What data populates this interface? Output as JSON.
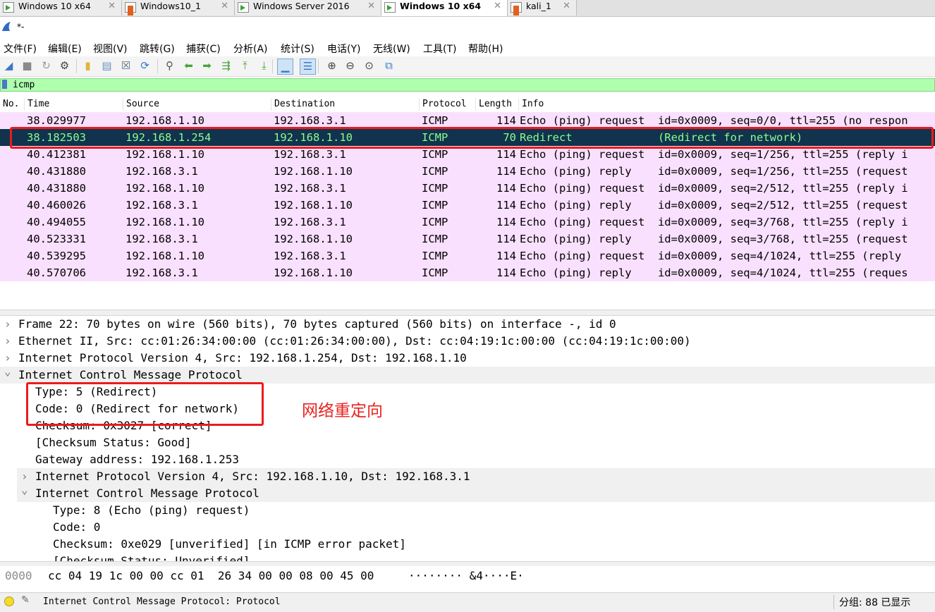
{
  "vm_tabs": [
    {
      "label": "Windows 10 x64",
      "icon": "vm-icon",
      "active": false
    },
    {
      "label": "Windows10_1",
      "icon": "vm-red-icon",
      "active": false
    },
    {
      "label": "Windows Server 2016",
      "icon": "vm-icon",
      "active": false
    },
    {
      "label": "Windows 10 x64",
      "icon": "vm-icon",
      "active": true
    },
    {
      "label": "kali_1",
      "icon": "vm-red-icon",
      "active": false
    }
  ],
  "close_glyph": "✕",
  "app": {
    "title": "*-",
    "icon": "shark-fin-icon"
  },
  "menu": [
    "文件(F)",
    "编辑(E)",
    "视图(V)",
    "跳转(G)",
    "捕获(C)",
    "分析(A)",
    "统计(S)",
    "电话(Y)",
    "无线(W)",
    "工具(T)",
    "帮助(H)"
  ],
  "toolbar": [
    {
      "name": "start-capture-icon",
      "glyph": "◢",
      "color": "#3a77c9"
    },
    {
      "name": "stop-capture-icon",
      "glyph": "■",
      "color": "#8a8a8a"
    },
    {
      "name": "restart-capture-icon",
      "glyph": "↻",
      "color": "#9a9a9a"
    },
    {
      "name": "capture-options-icon",
      "glyph": "⚙",
      "color": "#444444"
    },
    {
      "name": "open-file-icon",
      "glyph": "▮",
      "color": "#e2b23a"
    },
    {
      "name": "save-file-icon",
      "glyph": "▤",
      "color": "#6b8fbf"
    },
    {
      "name": "close-file-icon",
      "glyph": "☒",
      "color": "#5a6b80"
    },
    {
      "name": "reload-file-icon",
      "glyph": "⟳",
      "color": "#3a77c9"
    },
    {
      "name": "find-packet-icon",
      "glyph": "⚲",
      "color": "#555555"
    },
    {
      "name": "go-back-icon",
      "glyph": "⬅",
      "color": "#49a53a"
    },
    {
      "name": "go-forward-icon",
      "glyph": "➡",
      "color": "#49a53a"
    },
    {
      "name": "go-to-packet-icon",
      "glyph": "⇶",
      "color": "#49a53a"
    },
    {
      "name": "first-packet-icon",
      "glyph": "⤒",
      "color": "#49a53a"
    },
    {
      "name": "last-packet-icon",
      "glyph": "⤓",
      "color": "#49a53a"
    },
    {
      "name": "auto-scroll-icon",
      "glyph": "▁",
      "color": "#3a77c9"
    },
    {
      "name": "colorize-icon",
      "glyph": "☰",
      "color": "#3a77c9"
    },
    {
      "name": "zoom-in-icon",
      "glyph": "⊕",
      "color": "#444444"
    },
    {
      "name": "zoom-out-icon",
      "glyph": "⊖",
      "color": "#444444"
    },
    {
      "name": "zoom-normal-icon",
      "glyph": "⊙",
      "color": "#444444"
    },
    {
      "name": "resize-columns-icon",
      "glyph": "⧉",
      "color": "#3a77c9"
    }
  ],
  "filter": {
    "value": "icmp"
  },
  "columns": [
    "No.",
    "Time",
    "Source",
    "Destination",
    "Protocol",
    "Length",
    "Info"
  ],
  "packets": [
    {
      "time": "38.029977",
      "source": "192.168.1.10",
      "destination": "192.168.3.1",
      "protocol": "ICMP",
      "length": "114",
      "info": "Echo (ping) request  id=0x0009, seq=0/0, ttl=255 (no respon",
      "selected": false
    },
    {
      "time": "38.182503",
      "source": "192.168.1.254",
      "destination": "192.168.1.10",
      "protocol": "ICMP",
      "length": "70",
      "info": "Redirect             (Redirect for network)",
      "selected": true
    },
    {
      "time": "40.412381",
      "source": "192.168.1.10",
      "destination": "192.168.3.1",
      "protocol": "ICMP",
      "length": "114",
      "info": "Echo (ping) request  id=0x0009, seq=1/256, ttl=255 (reply i",
      "selected": false
    },
    {
      "time": "40.431880",
      "source": "192.168.3.1",
      "destination": "192.168.1.10",
      "protocol": "ICMP",
      "length": "114",
      "info": "Echo (ping) reply    id=0x0009, seq=1/256, ttl=255 (request",
      "selected": false
    },
    {
      "time": "40.431880",
      "source": "192.168.1.10",
      "destination": "192.168.3.1",
      "protocol": "ICMP",
      "length": "114",
      "info": "Echo (ping) request  id=0x0009, seq=2/512, ttl=255 (reply i",
      "selected": false
    },
    {
      "time": "40.460026",
      "source": "192.168.3.1",
      "destination": "192.168.1.10",
      "protocol": "ICMP",
      "length": "114",
      "info": "Echo (ping) reply    id=0x0009, seq=2/512, ttl=255 (request",
      "selected": false
    },
    {
      "time": "40.494055",
      "source": "192.168.1.10",
      "destination": "192.168.3.1",
      "protocol": "ICMP",
      "length": "114",
      "info": "Echo (ping) request  id=0x0009, seq=3/768, ttl=255 (reply i",
      "selected": false
    },
    {
      "time": "40.523331",
      "source": "192.168.3.1",
      "destination": "192.168.1.10",
      "protocol": "ICMP",
      "length": "114",
      "info": "Echo (ping) reply    id=0x0009, seq=3/768, ttl=255 (request",
      "selected": false
    },
    {
      "time": "40.539295",
      "source": "192.168.1.10",
      "destination": "192.168.3.1",
      "protocol": "ICMP",
      "length": "114",
      "info": "Echo (ping) request  id=0x0009, seq=4/1024, ttl=255 (reply ",
      "selected": false
    },
    {
      "time": "40.570706",
      "source": "192.168.3.1",
      "destination": "192.168.1.10",
      "protocol": "ICMP",
      "length": "114",
      "info": "Echo (ping) reply    id=0x0009, seq=4/1024, ttl=255 (reques",
      "selected": false
    }
  ],
  "details": [
    {
      "text": "Frame 22: 70 bytes on wire (560 bits), 70 bytes captured (560 bits) on interface -, id 0",
      "level": 0,
      "arrow": "collapsed",
      "highlight": false
    },
    {
      "text": "Ethernet II, Src: cc:01:26:34:00:00 (cc:01:26:34:00:00), Dst: cc:04:19:1c:00:00 (cc:04:19:1c:00:00)",
      "level": 0,
      "arrow": "collapsed",
      "highlight": false
    },
    {
      "text": "Internet Protocol Version 4, Src: 192.168.1.254, Dst: 192.168.1.10",
      "level": 0,
      "arrow": "collapsed",
      "highlight": false
    },
    {
      "text": "Internet Control Message Protocol",
      "level": 0,
      "arrow": "expanded",
      "highlight": true
    },
    {
      "text": "Type: 5 (Redirect)",
      "level": 1,
      "arrow": "",
      "highlight": false
    },
    {
      "text": "Code: 0 (Redirect for network)",
      "level": 1,
      "arrow": "",
      "highlight": false
    },
    {
      "text": "Checksum: 0x3027 [correct]",
      "level": 1,
      "arrow": "",
      "highlight": false
    },
    {
      "text": "[Checksum Status: Good]",
      "level": 1,
      "arrow": "",
      "highlight": false
    },
    {
      "text": "Gateway address: 192.168.1.253",
      "level": 1,
      "arrow": "",
      "highlight": false
    },
    {
      "text": "Internet Protocol Version 4, Src: 192.168.1.10, Dst: 192.168.3.1",
      "level": 1,
      "arrow": "collapsed",
      "highlight": true
    },
    {
      "text": "Internet Control Message Protocol",
      "level": 1,
      "arrow": "expanded",
      "highlight": true
    },
    {
      "text": "Type: 8 (Echo (ping) request)",
      "level": 2,
      "arrow": "",
      "highlight": false
    },
    {
      "text": "Code: 0",
      "level": 2,
      "arrow": "",
      "highlight": false
    },
    {
      "text": "Checksum: 0xe029 [unverified] [in ICMP error packet]",
      "level": 2,
      "arrow": "",
      "highlight": false
    },
    {
      "text": "[Checksum Status: Unverified]",
      "level": 2,
      "arrow": "",
      "highlight": false
    }
  ],
  "bytes": {
    "offset": "0000",
    "hex": "cc 04 19 1c 00 00 cc 01  26 34 00 00 08 00 45 00",
    "ascii": "········ &4····E·"
  },
  "status": {
    "text": "Internet Control Message Protocol: Protocol",
    "right": "分组: 88 已显示"
  },
  "annotation": {
    "text": "网络重定向",
    "color": "#e8231f"
  },
  "colors": {
    "selected_bg": "#11334d",
    "selected_fg": "#8dfc8d",
    "row_bg": "#fae0ff",
    "filter_bg": "#afffaf"
  }
}
